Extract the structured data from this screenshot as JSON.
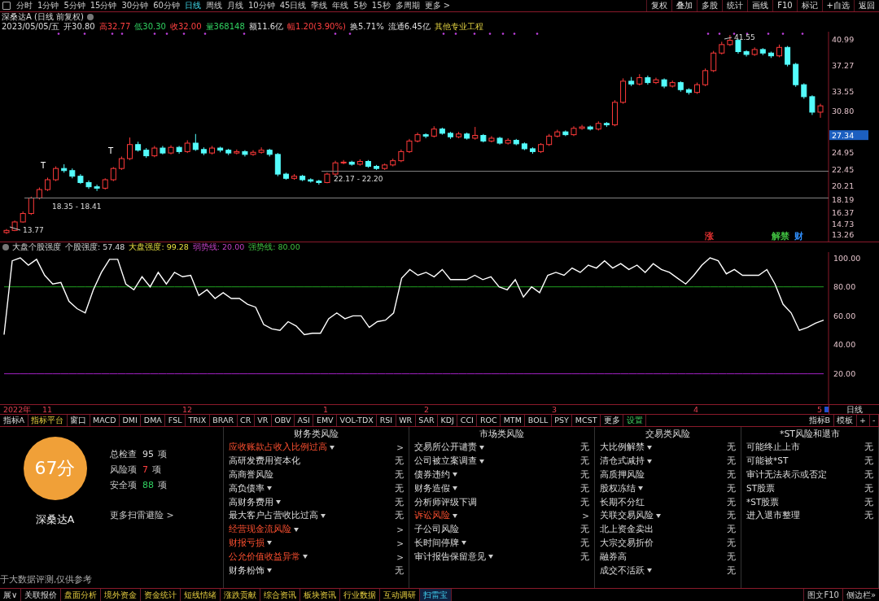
{
  "toolbar": {
    "periods": [
      {
        "label": "分时",
        "selected": false
      },
      {
        "label": "1分钟",
        "selected": false
      },
      {
        "label": "5分钟",
        "selected": false
      },
      {
        "label": "15分钟",
        "selected": false
      },
      {
        "label": "30分钟",
        "selected": false
      },
      {
        "label": "60分钟",
        "selected": false
      },
      {
        "label": "日线",
        "selected": true
      },
      {
        "label": "周线",
        "selected": false
      },
      {
        "label": "月线",
        "selected": false
      },
      {
        "label": "10分钟",
        "selected": false
      },
      {
        "label": "45日线",
        "selected": false
      },
      {
        "label": "季线",
        "selected": false
      },
      {
        "label": "年线",
        "selected": false
      },
      {
        "label": "5秒",
        "selected": false
      },
      {
        "label": "15秒",
        "selected": false
      },
      {
        "label": "多周期",
        "selected": false
      },
      {
        "label": "更多 >",
        "selected": false
      }
    ],
    "actions": [
      "复权",
      "叠加",
      "多股",
      "统计",
      "画线",
      "F10",
      "标记",
      "+自选",
      "返回"
    ]
  },
  "stock_header": {
    "title": "深桑达A (日线 前复权)",
    "quote": [
      {
        "text": "2023/05/05/五",
        "kind": "flat"
      },
      {
        "text": "开30.80",
        "kind": "flat"
      },
      {
        "text": "高32.77",
        "kind": "up"
      },
      {
        "text": "低30.30",
        "kind": "down"
      },
      {
        "text": "收32.00",
        "kind": "up"
      },
      {
        "text": "量368148",
        "kind": "down"
      },
      {
        "text": "额11.6亿",
        "kind": "flat"
      },
      {
        "text": "幅1.20(3.90%)",
        "kind": "up"
      },
      {
        "text": "换5.71%",
        "kind": "flat"
      },
      {
        "text": "流通6.45亿",
        "kind": "flat"
      },
      {
        "text": "其他专业工程",
        "kind": "note"
      }
    ]
  },
  "price_chart": {
    "chart_data": {
      "type": "candlestick",
      "ylim": [
        12.22,
        42.03
      ],
      "yticks": [
        {
          "value": 40.99,
          "label": "40.99"
        },
        {
          "value": 37.27,
          "label": "37.27"
        },
        {
          "value": 33.55,
          "label": "33.55"
        },
        {
          "value": 30.8,
          "label": "30.80"
        },
        {
          "value": 24.95,
          "label": "24.95"
        },
        {
          "value": 22.45,
          "label": "22.45"
        },
        {
          "value": 20.21,
          "label": "20.21"
        },
        {
          "value": 18.19,
          "label": "18.19"
        },
        {
          "value": 16.37,
          "label": "16.37"
        },
        {
          "value": 14.73,
          "label": "14.73"
        },
        {
          "value": 13.26,
          "label": "13.26"
        }
      ],
      "ohlc": [
        [
          13.5,
          14.0,
          13.3,
          13.8
        ],
        [
          13.8,
          15.2,
          13.7,
          15.0
        ],
        [
          15.0,
          16.5,
          14.9,
          16.2
        ],
        [
          16.2,
          18.6,
          16.0,
          18.4
        ],
        [
          18.4,
          19.9,
          18.2,
          19.6
        ],
        [
          19.6,
          21.3,
          19.4,
          21.0
        ],
        [
          21.0,
          22.9,
          20.8,
          22.6
        ],
        [
          22.6,
          23.2,
          22.0,
          22.3
        ],
        [
          22.3,
          22.6,
          21.2,
          21.5
        ],
        [
          21.5,
          21.8,
          20.4,
          20.6
        ],
        [
          20.6,
          20.9,
          19.7,
          20.0
        ],
        [
          20.0,
          20.3,
          19.4,
          19.8
        ],
        [
          19.8,
          21.2,
          19.6,
          21.0
        ],
        [
          21.0,
          22.8,
          20.8,
          22.6
        ],
        [
          22.6,
          24.3,
          22.4,
          24.0
        ],
        [
          24.0,
          27.0,
          23.8,
          26.0
        ],
        [
          26.0,
          26.4,
          25.0,
          25.2
        ],
        [
          25.2,
          25.5,
          24.1,
          24.4
        ],
        [
          24.4,
          25.8,
          24.2,
          25.5
        ],
        [
          25.5,
          25.8,
          24.6,
          24.8
        ],
        [
          24.8,
          25.9,
          24.6,
          25.6
        ],
        [
          25.6,
          25.8,
          24.7,
          25.0
        ],
        [
          25.0,
          26.6,
          24.8,
          26.2
        ],
        [
          26.2,
          27.5,
          25.1,
          25.3
        ],
        [
          25.3,
          25.6,
          24.5,
          24.8
        ],
        [
          24.8,
          25.8,
          24.6,
          25.5
        ],
        [
          25.5,
          25.7,
          24.9,
          25.2
        ],
        [
          25.2,
          25.4,
          24.5,
          24.8
        ],
        [
          24.8,
          25.3,
          24.6,
          25.0
        ],
        [
          25.0,
          25.2,
          24.3,
          24.6
        ],
        [
          24.6,
          25.2,
          24.4,
          24.9
        ],
        [
          24.9,
          25.6,
          24.7,
          25.2
        ],
        [
          25.2,
          25.4,
          24.3,
          24.6
        ],
        [
          24.6,
          24.8,
          21.5,
          21.8
        ],
        [
          21.8,
          22.0,
          21.0,
          21.2
        ],
        [
          21.2,
          21.8,
          21.0,
          21.5
        ],
        [
          21.5,
          21.7,
          20.8,
          21.0
        ],
        [
          21.0,
          21.2,
          20.6,
          20.8
        ],
        [
          20.8,
          21.0,
          20.3,
          20.6
        ],
        [
          20.6,
          22.0,
          20.5,
          21.8
        ],
        [
          21.8,
          23.7,
          21.6,
          23.4
        ],
        [
          23.4,
          23.8,
          23.2,
          23.5
        ],
        [
          23.5,
          23.7,
          23.0,
          23.2
        ],
        [
          23.2,
          23.9,
          23.0,
          23.6
        ],
        [
          23.6,
          23.8,
          22.7,
          22.9
        ],
        [
          22.9,
          23.1,
          22.4,
          22.6
        ],
        [
          22.6,
          23.3,
          22.4,
          23.1
        ],
        [
          23.1,
          24.0,
          22.9,
          23.7
        ],
        [
          23.7,
          25.3,
          23.5,
          25.0
        ],
        [
          25.0,
          26.8,
          24.8,
          26.5
        ],
        [
          26.5,
          27.7,
          26.3,
          27.4
        ],
        [
          27.4,
          27.6,
          26.9,
          27.2
        ],
        [
          27.2,
          28.6,
          27.0,
          28.2
        ],
        [
          28.2,
          28.4,
          27.4,
          27.6
        ],
        [
          27.6,
          27.8,
          26.8,
          27.1
        ],
        [
          27.1,
          27.8,
          26.9,
          27.5
        ],
        [
          27.5,
          27.7,
          26.7,
          26.9
        ],
        [
          26.9,
          28.5,
          26.7,
          27.3
        ],
        [
          27.3,
          27.5,
          26.3,
          26.5
        ],
        [
          26.5,
          27.2,
          26.3,
          26.9
        ],
        [
          26.9,
          27.1,
          26.0,
          26.2
        ],
        [
          26.2,
          26.9,
          26.0,
          26.6
        ],
        [
          26.6,
          26.8,
          25.9,
          26.1
        ],
        [
          26.1,
          26.3,
          25.2,
          25.4
        ],
        [
          25.4,
          25.6,
          24.7,
          25.0
        ],
        [
          25.0,
          26.2,
          24.8,
          26.0
        ],
        [
          26.0,
          27.5,
          25.8,
          27.2
        ],
        [
          27.2,
          28.1,
          27.0,
          27.8
        ],
        [
          27.8,
          28.0,
          27.2,
          27.4
        ],
        [
          27.4,
          28.6,
          27.2,
          28.3
        ],
        [
          28.3,
          28.8,
          28.1,
          28.5
        ],
        [
          28.5,
          28.7,
          28.0,
          28.2
        ],
        [
          28.2,
          29.3,
          28.0,
          29.0
        ],
        [
          29.0,
          29.2,
          28.5,
          28.8
        ],
        [
          28.8,
          32.3,
          28.6,
          32.0
        ],
        [
          32.0,
          35.4,
          31.8,
          35.0
        ],
        [
          35.0,
          35.6,
          34.3,
          34.6
        ],
        [
          34.6,
          36.0,
          34.4,
          35.5
        ],
        [
          35.5,
          35.8,
          34.5,
          34.8
        ],
        [
          34.8,
          35.5,
          34.6,
          35.2
        ],
        [
          35.2,
          35.4,
          34.0,
          34.3
        ],
        [
          34.3,
          35.1,
          34.1,
          34.8
        ],
        [
          34.8,
          35.0,
          33.5,
          33.8
        ],
        [
          33.8,
          34.0,
          33.1,
          33.4
        ],
        [
          33.4,
          34.8,
          33.2,
          34.5
        ],
        [
          34.5,
          36.8,
          34.3,
          36.5
        ],
        [
          36.5,
          39.3,
          36.3,
          39.0
        ],
        [
          39.0,
          40.6,
          38.8,
          40.2
        ],
        [
          40.2,
          41.55,
          40.0,
          40.8
        ],
        [
          40.8,
          41.0,
          38.9,
          39.2
        ],
        [
          39.2,
          39.4,
          38.5,
          38.8
        ],
        [
          38.8,
          39.8,
          38.6,
          39.5
        ],
        [
          39.5,
          39.7,
          38.7,
          39.0
        ],
        [
          39.0,
          39.2,
          38.3,
          38.6
        ],
        [
          38.6,
          40.2,
          38.4,
          39.8
        ],
        [
          39.8,
          40.0,
          37.1,
          37.4
        ],
        [
          37.4,
          37.6,
          34.2,
          34.5
        ],
        [
          34.5,
          34.7,
          32.5,
          32.8
        ],
        [
          32.8,
          33.0,
          30.2,
          30.6
        ],
        [
          30.6,
          31.8,
          29.8,
          31.5
        ]
      ]
    },
    "current_price": "27.34",
    "price_notes": [
      "41.55",
      "22.17 - 22.20",
      "18.35 - 18.41",
      "13.77"
    ],
    "trade_marks": [
      "T",
      "T"
    ],
    "event_tags": [
      {
        "text": "涨",
        "kind": "rise"
      },
      {
        "text": "解禁",
        "kind": "unlock"
      },
      {
        "text": "财",
        "kind": "finance"
      }
    ]
  },
  "indicator": {
    "legend": [
      {
        "text": "大盘个股强度",
        "kind": "plain"
      },
      {
        "text": "个股强度: 57.48",
        "kind": "plain"
      },
      {
        "text": "大盘强度: 99.28",
        "kind": "market"
      },
      {
        "text": "弱势线: 20.00",
        "kind": "weak"
      },
      {
        "text": "强势线: 80.00",
        "kind": "strong"
      }
    ],
    "chart_data": {
      "type": "line",
      "ylim": [
        -1,
        104
      ],
      "yticks": [
        {
          "value": 20,
          "label": "20.00"
        },
        {
          "value": 40,
          "label": "40.00"
        },
        {
          "value": 60,
          "label": "60.00"
        },
        {
          "value": 80,
          "label": "80.00"
        },
        {
          "value": 100,
          "label": "100.00"
        }
      ],
      "series": [
        {
          "color": "#ffffff",
          "values": [
            47,
            98,
            100,
            95,
            99,
            88,
            82,
            83,
            70,
            65,
            62,
            78,
            90,
            99,
            99,
            82,
            78,
            87,
            80,
            90,
            82,
            90,
            87,
            88,
            74,
            78,
            72,
            76,
            72,
            72,
            68,
            66,
            54,
            51,
            50,
            56,
            53,
            47,
            48,
            48,
            58,
            62,
            58,
            60,
            60,
            52,
            56,
            57,
            62,
            86,
            92,
            88,
            90,
            87,
            92,
            85,
            85,
            85,
            88,
            85,
            87,
            80,
            78,
            85,
            73,
            80,
            76,
            88,
            90,
            88,
            93,
            90,
            95,
            93,
            98,
            93,
            96,
            92,
            95,
            90,
            96,
            92,
            90,
            86,
            82,
            88,
            95,
            100,
            98,
            89,
            92,
            88,
            88,
            88,
            92,
            82,
            68,
            62,
            50,
            52,
            55,
            57
          ]
        },
        {
          "color": "#a020c0",
          "values": [
            20,
            20,
            20,
            20,
            20,
            20,
            20,
            20,
            20,
            20,
            20,
            20,
            20,
            20,
            20,
            20,
            20,
            20,
            20,
            20,
            20,
            20,
            20,
            20,
            20,
            20,
            20,
            20,
            20,
            20,
            20,
            20,
            20,
            20,
            20,
            20,
            20,
            20,
            20,
            20,
            20,
            20,
            20,
            20,
            20,
            20,
            20,
            20,
            20,
            20,
            20,
            20,
            20,
            20,
            20,
            20,
            20,
            20,
            20,
            20,
            20,
            20,
            20,
            20,
            20,
            20,
            20,
            20,
            20,
            20,
            20,
            20,
            20,
            20,
            20,
            20,
            20,
            20,
            20,
            20,
            20,
            20,
            20,
            20,
            20,
            20,
            20,
            20,
            20,
            20,
            20,
            20,
            20,
            20,
            20,
            20,
            20,
            20,
            20,
            20,
            20,
            20
          ]
        },
        {
          "color": "#20a020",
          "values": [
            80,
            80,
            80,
            80,
            80,
            80,
            80,
            80,
            80,
            80,
            80,
            80,
            80,
            80,
            80,
            80,
            80,
            80,
            80,
            80,
            80,
            80,
            80,
            80,
            80,
            80,
            80,
            80,
            80,
            80,
            80,
            80,
            80,
            80,
            80,
            80,
            80,
            80,
            80,
            80,
            80,
            80,
            80,
            80,
            80,
            80,
            80,
            80,
            80,
            80,
            80,
            80,
            80,
            80,
            80,
            80,
            80,
            80,
            80,
            80,
            80,
            80,
            80,
            80,
            80,
            80,
            80,
            80,
            80,
            80,
            80,
            80,
            80,
            80,
            80,
            80,
            80,
            80,
            80,
            80,
            80,
            80,
            80,
            80,
            80,
            80,
            80,
            80,
            80,
            80,
            80,
            80,
            80,
            80,
            80,
            80,
            80,
            80,
            80,
            80,
            80,
            80
          ]
        }
      ]
    }
  },
  "date_axis": {
    "labels": [
      "2022年",
      "11",
      "12",
      "1",
      "2",
      "3",
      "4",
      "5"
    ],
    "period_button": "日线"
  },
  "indicator_tabs": {
    "left": [
      {
        "label": "指标A",
        "kind": "plain"
      },
      {
        "label": "指标平台",
        "kind": "platform"
      },
      {
        "label": "窗口",
        "kind": "plain"
      },
      {
        "label": "MACD",
        "kind": "plain"
      },
      {
        "label": "DMI",
        "kind": "plain"
      },
      {
        "label": "DMA",
        "kind": "plain"
      },
      {
        "label": "FSL",
        "kind": "plain"
      },
      {
        "label": "TRIX",
        "kind": "plain"
      },
      {
        "label": "BRAR",
        "kind": "plain"
      },
      {
        "label": "CR",
        "kind": "plain"
      },
      {
        "label": "VR",
        "kind": "plain"
      },
      {
        "label": "OBV",
        "kind": "plain"
      },
      {
        "label": "ASI",
        "kind": "plain"
      },
      {
        "label": "EMV",
        "kind": "plain"
      },
      {
        "label": "VOL-TDX",
        "kind": "plain"
      },
      {
        "label": "RSI",
        "kind": "plain"
      },
      {
        "label": "WR",
        "kind": "plain"
      },
      {
        "label": "SAR",
        "kind": "plain"
      },
      {
        "label": "KDJ",
        "kind": "plain"
      },
      {
        "label": "CCI",
        "kind": "plain"
      },
      {
        "label": "ROC",
        "kind": "plain"
      },
      {
        "label": "MTM",
        "kind": "plain"
      },
      {
        "label": "BOLL",
        "kind": "plain"
      },
      {
        "label": "PSY",
        "kind": "plain"
      },
      {
        "label": "MCST",
        "kind": "plain"
      },
      {
        "label": "更多",
        "kind": "plain"
      },
      {
        "label": "设置",
        "kind": "settings"
      }
    ],
    "right": [
      "指标B",
      "模板",
      "+",
      "-"
    ]
  },
  "risk_scan": {
    "score": "67分",
    "stock": "深桑达A",
    "stats": [
      {
        "label": "总检查",
        "count": "95",
        "unit": "项",
        "kind": "total"
      },
      {
        "label": "风险项",
        "count": "7",
        "unit": "项",
        "kind": "risk"
      },
      {
        "label": "安全项",
        "count": "88",
        "unit": "项",
        "kind": "safe"
      }
    ],
    "more_link": "更多扫雷避险 >",
    "disclaimer": "于大数据评测,仅供参考",
    "categories": [
      {
        "title": "财务类风险",
        "items": [
          {
            "name": "应收账款占收入比例过高",
            "flagged": true,
            "expandable": true,
            "status": ">"
          },
          {
            "name": "高研发费用资本化",
            "flagged": false,
            "expandable": false,
            "status": "无"
          },
          {
            "name": "高商誉风险",
            "flagged": false,
            "expandable": false,
            "status": "无"
          },
          {
            "name": "高负债率",
            "flagged": false,
            "expandable": true,
            "status": "无"
          },
          {
            "name": "高财务费用",
            "flagged": false,
            "expandable": true,
            "status": "无"
          },
          {
            "name": "最大客户占营收比过高",
            "flagged": false,
            "expandable": true,
            "status": "无"
          },
          {
            "name": "经营现金流风险",
            "flagged": true,
            "expandable": true,
            "status": ">"
          },
          {
            "name": "财报亏损",
            "flagged": true,
            "expandable": true,
            "status": ">"
          },
          {
            "name": "公允价值收益异常",
            "flagged": true,
            "expandable": true,
            "status": ">"
          },
          {
            "name": "财务粉饰",
            "flagged": false,
            "expandable": true,
            "status": "无"
          }
        ]
      },
      {
        "title": "市场类风险",
        "items": [
          {
            "name": "交易所公开谴责",
            "flagged": false,
            "expandable": true,
            "status": "无"
          },
          {
            "name": "公司被立案调查",
            "flagged": false,
            "expandable": true,
            "status": "无"
          },
          {
            "name": "债券违约",
            "flagged": false,
            "expandable": true,
            "status": "无"
          },
          {
            "name": "财务造假",
            "flagged": false,
            "expandable": true,
            "status": "无"
          },
          {
            "name": "分析师评级下调",
            "flagged": false,
            "expandable": false,
            "status": "无"
          },
          {
            "name": "诉讼风险",
            "flagged": true,
            "expandable": true,
            "status": ">"
          },
          {
            "name": "子公司风险",
            "flagged": false,
            "expandable": false,
            "status": "无"
          },
          {
            "name": "长时间停牌",
            "flagged": false,
            "expandable": true,
            "status": "无"
          },
          {
            "name": "审计报告保留意见",
            "flagged": false,
            "expandable": true,
            "status": "无"
          }
        ]
      },
      {
        "title": "交易类风险",
        "items": [
          {
            "name": "大比例解禁",
            "flagged": false,
            "expandable": true,
            "status": "无"
          },
          {
            "name": "清仓式减持",
            "flagged": false,
            "expandable": true,
            "status": "无"
          },
          {
            "name": "高质押风险",
            "flagged": false,
            "expandable": false,
            "status": "无"
          },
          {
            "name": "股权冻结",
            "flagged": false,
            "expandable": true,
            "status": "无"
          },
          {
            "name": "长期不分红",
            "flagged": false,
            "expandable": false,
            "status": "无"
          },
          {
            "name": "关联交易风险",
            "flagged": false,
            "expandable": true,
            "status": "无"
          },
          {
            "name": "北上资金卖出",
            "flagged": false,
            "expandable": false,
            "status": "无"
          },
          {
            "name": "大宗交易折价",
            "flagged": false,
            "expandable": false,
            "status": "无"
          },
          {
            "name": "融券高",
            "flagged": false,
            "expandable": false,
            "status": "无"
          },
          {
            "name": "成交不活跃",
            "flagged": false,
            "expandable": true,
            "status": "无"
          }
        ]
      },
      {
        "title": "*ST风险和退市",
        "items": [
          {
            "name": "可能终止上市",
            "flagged": false,
            "expandable": false,
            "status": "无"
          },
          {
            "name": "可能被*ST",
            "flagged": false,
            "expandable": false,
            "status": "无"
          },
          {
            "name": "审计无法表示或否定",
            "flagged": false,
            "expandable": false,
            "status": "无"
          },
          {
            "name": "ST股票",
            "flagged": false,
            "expandable": false,
            "status": "无"
          },
          {
            "name": "*ST股票",
            "flagged": false,
            "expandable": false,
            "status": "无"
          },
          {
            "name": "进入退市整理",
            "flagged": false,
            "expandable": false,
            "status": "无"
          }
        ]
      }
    ]
  },
  "bottom_tabs": [
    {
      "label": "展∨",
      "kind": "plain",
      "selected": false
    },
    {
      "label": "关联报价",
      "kind": "plain",
      "selected": false
    },
    {
      "label": "盘面分析",
      "kind": "feature",
      "selected": false
    },
    {
      "label": "境外资金",
      "kind": "feature",
      "selected": false
    },
    {
      "label": "资金统计",
      "kind": "feature",
      "selected": false
    },
    {
      "label": "短线情绪",
      "kind": "feature",
      "selected": false
    },
    {
      "label": "涨跌贡献",
      "kind": "feature",
      "selected": false
    },
    {
      "label": "综合资讯",
      "kind": "feature",
      "selected": false
    },
    {
      "label": "板块资讯",
      "kind": "feature",
      "selected": false
    },
    {
      "label": "行业数据",
      "kind": "feature",
      "selected": false
    },
    {
      "label": "互动调研",
      "kind": "feature",
      "selected": false
    },
    {
      "label": "扫雷宝",
      "kind": "feature",
      "selected": true
    }
  ],
  "footer_buttons": [
    "图文F10",
    "侧边栏»"
  ]
}
